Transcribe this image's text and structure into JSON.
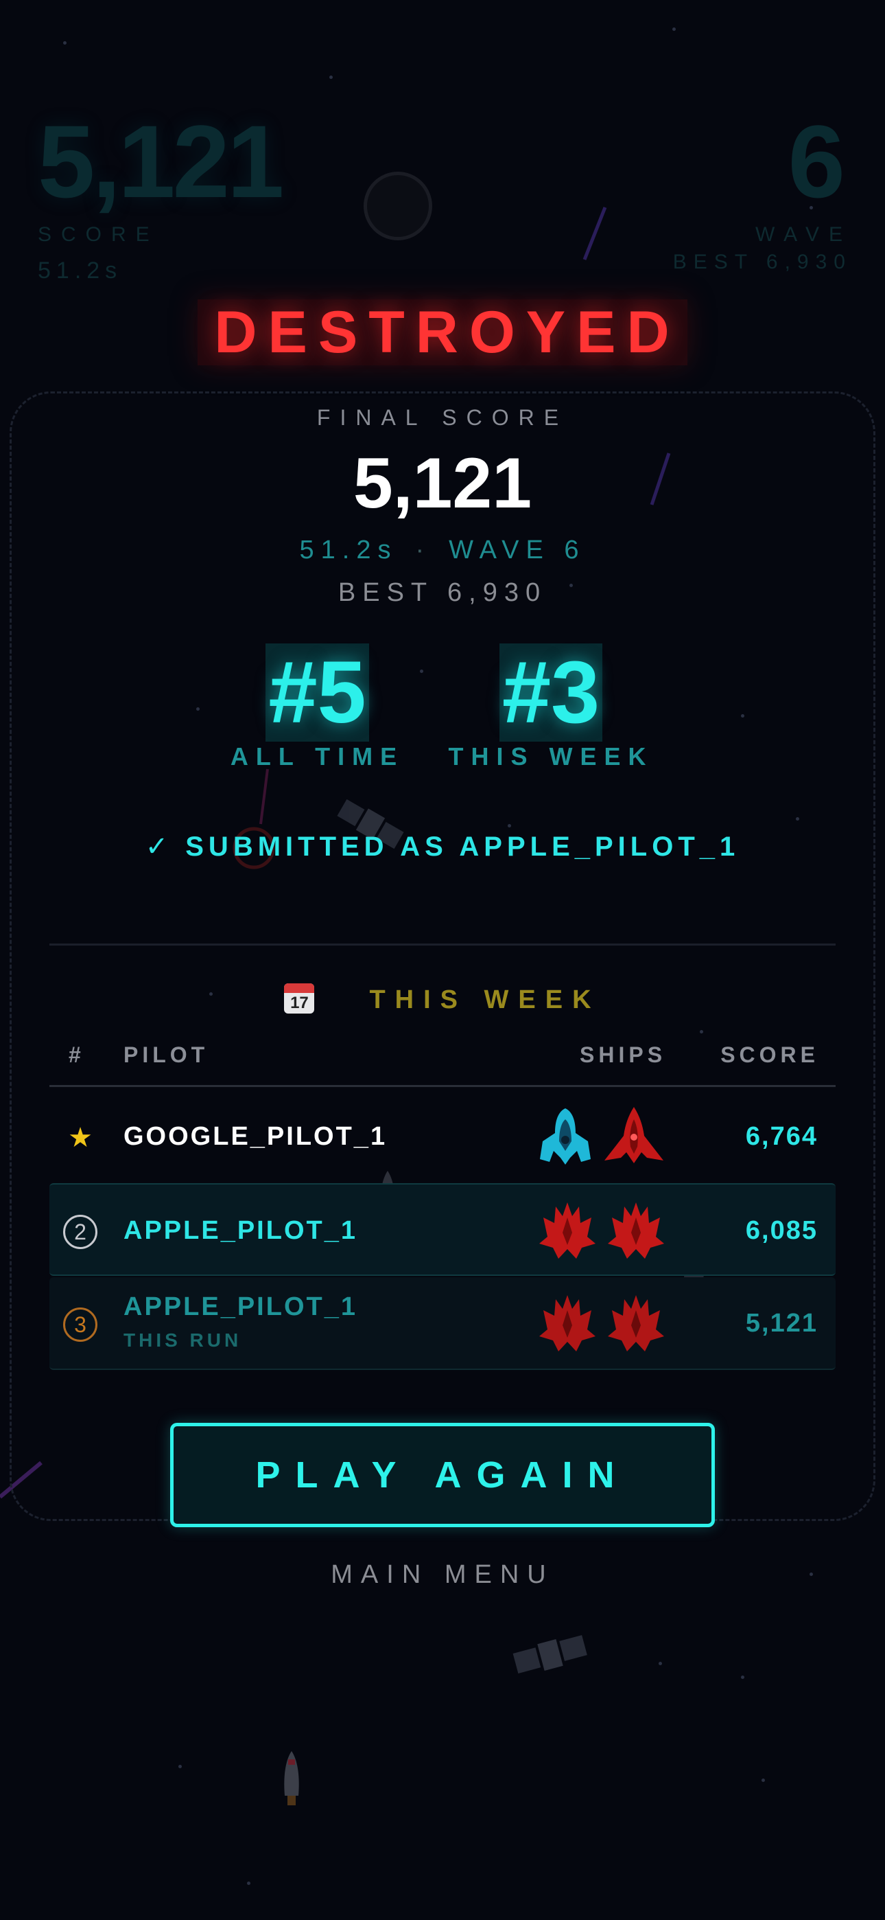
{
  "hud": {
    "score": "5,121",
    "score_label": "SCORE",
    "time": "51.2s",
    "wave": "6",
    "wave_label": "WAVE",
    "best": "BEST  6,930"
  },
  "title": "DESTROYED",
  "summary": {
    "final_label": "FINAL SCORE",
    "final_score": "5,121",
    "time": "51.2s",
    "separator": "·",
    "wave": "WAVE 6",
    "best": "BEST  6,930"
  },
  "ranks": [
    {
      "value": "#5",
      "label": "ALL TIME"
    },
    {
      "value": "#3",
      "label": "THIS WEEK"
    }
  ],
  "submitted": {
    "check": "✓",
    "text": "SUBMITTED AS APPLE_PILOT_1"
  },
  "leaderboard": {
    "title": "THIS WEEK",
    "calendar_day": "17",
    "columns": {
      "rank": "#",
      "pilot": "PILOT",
      "ships": "SHIPS",
      "score": "SCORE"
    },
    "rows": [
      {
        "rank": "★",
        "pilot": "GOOGLE_PILOT_1",
        "sub": "",
        "ships": [
          "cyan-fighter-icon",
          "red-wing-fighter-icon"
        ],
        "score": "6,764"
      },
      {
        "rank": "2",
        "pilot": "APPLE_PILOT_1",
        "sub": "",
        "ships": [
          "red-claw-fighter-icon",
          "red-claw-fighter-icon"
        ],
        "score": "6,085"
      },
      {
        "rank": "3",
        "pilot": "APPLE_PILOT_1",
        "sub": "THIS RUN",
        "ships": [
          "red-claw-fighter-icon",
          "red-claw-fighter-icon"
        ],
        "score": "5,121"
      }
    ]
  },
  "buttons": {
    "play_again": "PLAY AGAIN",
    "main_menu": "MAIN MENU"
  },
  "colors": {
    "accent": "#2ef2ea",
    "danger": "#ff3434",
    "gold": "#f0c419",
    "week_title": "#9a8a1e",
    "background": "#05070f"
  }
}
